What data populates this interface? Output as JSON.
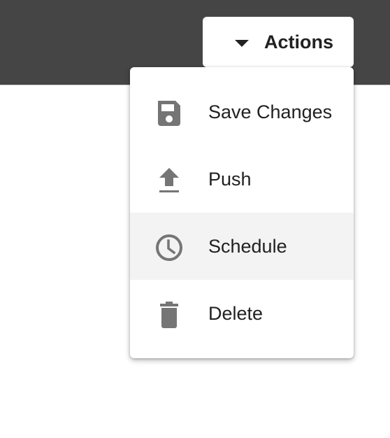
{
  "toolbar": {
    "actions_label": "Actions"
  },
  "menu": {
    "items": [
      {
        "label": "Save Changes",
        "icon": "save-icon",
        "highlighted": false
      },
      {
        "label": "Push",
        "icon": "upload-icon",
        "highlighted": false
      },
      {
        "label": "Schedule",
        "icon": "clock-icon",
        "highlighted": true
      },
      {
        "label": "Delete",
        "icon": "trash-icon",
        "highlighted": false
      }
    ]
  },
  "colors": {
    "topbar_background": "#454545",
    "icon_gray": "#757575",
    "highlight_background": "#f3f3f3",
    "text_dark": "#212121"
  }
}
